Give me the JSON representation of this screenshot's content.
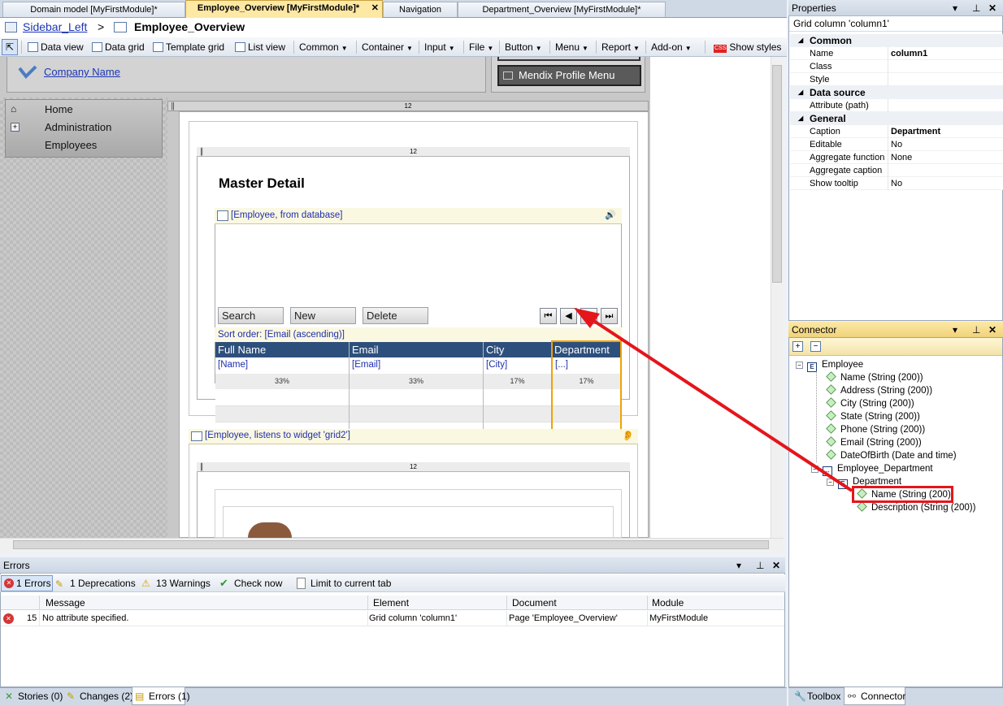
{
  "tabs": [
    {
      "label": "Domain model [MyFirstModule]*"
    },
    {
      "label": "Employee_Overview [MyFirstModule]*",
      "close": "✕"
    },
    {
      "label": "Navigation"
    },
    {
      "label": "Department_Overview [MyFirstModule]*"
    }
  ],
  "breadcrumb": {
    "layout": "Sidebar_Left",
    "separator": ">",
    "page": "Employee_Overview"
  },
  "toolbar": {
    "items": [
      "Data view",
      "Data grid",
      "Template grid",
      "List view",
      "Common",
      "Container",
      "Input",
      "File",
      "Button",
      "Menu",
      "Report",
      "Add-on"
    ],
    "show_styles": "Show styles",
    "css_badge": "CSS"
  },
  "canvas": {
    "company_link": "Company Name",
    "profile_menu": "Mendix Profile Menu",
    "sidebar": [
      {
        "label": "Home",
        "icon": "home-icon"
      },
      {
        "label": "Administration",
        "icon": "gear-icon"
      },
      {
        "label": "Employees",
        "icon": ""
      }
    ],
    "col_size": "12",
    "heading": "Master Detail",
    "grid_source": "[Employee, from database]",
    "buttons": [
      "Search",
      "New",
      "Delete"
    ],
    "sort_order": "Sort order: [Email (ascending)]",
    "columns": [
      {
        "header": "Full Name",
        "attr": "[Name]",
        "pct": "33%"
      },
      {
        "header": "Email",
        "attr": "[Email]",
        "pct": "33%"
      },
      {
        "header": "City",
        "attr": "[City]",
        "pct": "17%"
      },
      {
        "header": "Department",
        "attr": "[...]",
        "pct": "17%"
      }
    ],
    "listen_source": "[Employee, listens to widget 'grid2']"
  },
  "properties": {
    "title": "Properties",
    "subtitle": "Grid column 'column1'",
    "categories": [
      {
        "name": "Common",
        "rows": [
          [
            "Name",
            "column1"
          ],
          [
            "Class",
            ""
          ],
          [
            "Style",
            ""
          ]
        ]
      },
      {
        "name": "Data source",
        "rows": [
          [
            "Attribute (path)",
            ""
          ]
        ]
      },
      {
        "name": "General",
        "rows": [
          [
            "Caption",
            "Department"
          ],
          [
            "Editable",
            "No"
          ],
          [
            "Aggregate function",
            "None"
          ],
          [
            "Aggregate caption",
            ""
          ],
          [
            "Show tooltip",
            "No"
          ]
        ]
      }
    ]
  },
  "connector": {
    "title": "Connector",
    "tree": [
      {
        "label": "Employee",
        "kind": "entity"
      },
      {
        "label": "Name (String (200))",
        "kind": "attr"
      },
      {
        "label": "Address (String (200))",
        "kind": "attr"
      },
      {
        "label": "City (String (200))",
        "kind": "attr"
      },
      {
        "label": "State (String (200))",
        "kind": "attr"
      },
      {
        "label": "Phone (String (200))",
        "kind": "attr"
      },
      {
        "label": "Email (String (200))",
        "kind": "attr"
      },
      {
        "label": "DateOfBirth (Date and time)",
        "kind": "attr"
      },
      {
        "label": "Employee_Department",
        "kind": "assoc"
      },
      {
        "label": "Department",
        "kind": "entity"
      },
      {
        "label": "Name (String (200))",
        "kind": "attr"
      },
      {
        "label": "Description (String (200))",
        "kind": "attr"
      }
    ]
  },
  "errors": {
    "title": "Errors",
    "filters": [
      "1 Errors",
      "1 Deprecations",
      "13 Warnings",
      "Check now",
      "Limit to current tab"
    ],
    "columns": [
      "Message",
      "Element",
      "Document",
      "Module"
    ],
    "rows": [
      {
        "line": "15",
        "message": "No attribute specified.",
        "element": "Grid column 'column1'",
        "document": "Page 'Employee_Overview'",
        "module": "MyFirstModule"
      }
    ]
  },
  "bottom_tabs": [
    "Stories (0)",
    "Changes (2)",
    "Errors (1)"
  ],
  "right_tabs": [
    "Toolbox",
    "Connector"
  ],
  "pane_ctrl": {
    "pin": "▾",
    "close": "✕"
  },
  "colors": {
    "accent_orange": "#f2a200",
    "annotation_red": "#e4161b",
    "header_blue": "#2d4f7c"
  }
}
